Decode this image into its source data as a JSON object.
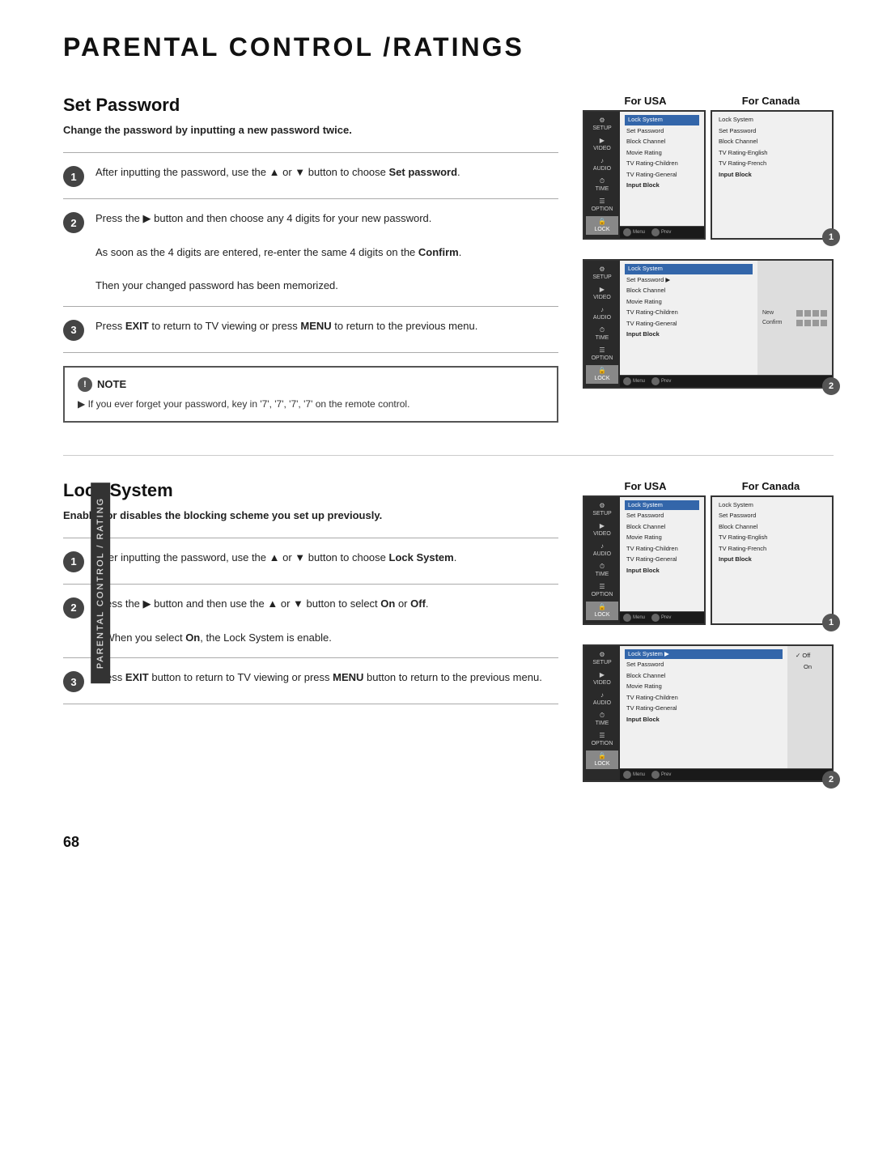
{
  "page": {
    "title": "PARENTAL CONTROL /RATINGS",
    "page_number": "68",
    "side_tab": "PARENTAL CONTROL / RATING"
  },
  "set_password": {
    "title": "Set Password",
    "subtitle": "Change the password by inputting a new password twice.",
    "steps": [
      {
        "number": "1",
        "text": "After inputting the password, use the ▲ or ▼ button to choose Set password."
      },
      {
        "number": "2",
        "text": "Press the ▶ button and then choose any 4 digits for your new password.\n\nAs soon as the 4 digits are entered, re-enter the same 4 digits on the Confirm.\n\nThen your changed password has been memorized."
      },
      {
        "number": "3",
        "text": "Press EXIT to return to TV viewing or press MENU to return to the previous menu."
      }
    ],
    "note": {
      "title": "NOTE",
      "text": "▶ If you ever forget your password, key in '7', '7', '7', '7' on the remote control."
    },
    "for_usa_label": "For USA",
    "for_canada_label": "For Canada",
    "screens": [
      {
        "badge": "1",
        "usa_menu": [
          "Lock System",
          "Set Password",
          "Block Channel",
          "Movie Rating",
          "TV Rating-Children",
          "TV Rating-General",
          "Input Block"
        ],
        "canada_menu": [
          "Lock System",
          "Set Password",
          "Block Channel",
          "TV Rating-English",
          "TV Rating-French",
          "Input Block"
        ],
        "selected_item": "Lock System",
        "sidebar": [
          "SETUP",
          "VIDEO",
          "AUDIO",
          "TIME",
          "OPTION",
          "LOCK"
        ]
      },
      {
        "badge": "2",
        "usa_menu": [
          "Lock System",
          "Set Password",
          "Block Channel",
          "Movie Rating",
          "TV Rating-Children",
          "TV Rating-General",
          "Input Block"
        ],
        "selected_item": "Lock System",
        "sidebar": [
          "SETUP",
          "VIDEO",
          "AUDIO",
          "TIME",
          "OPTION",
          "LOCK"
        ],
        "submenu": {
          "new_label": "New",
          "confirm_label": "Confirm",
          "dots": 4
        }
      }
    ]
  },
  "lock_system": {
    "title": "Lock System",
    "subtitle": "Enables or disables the blocking scheme you set up previously.",
    "steps": [
      {
        "number": "1",
        "text": "After inputting the password, use the ▲ or ▼ button to choose Lock System."
      },
      {
        "number": "2",
        "text": "Press the ▶ button and then use the ▲ or ▼ button to select On or Off.\n\n■ When you select On, the Lock System is enable."
      },
      {
        "number": "3",
        "text": "Press EXIT button to return to TV viewing or press MENU button to return to the previous menu."
      }
    ],
    "for_usa_label": "For USA",
    "for_canada_label": "For Canada",
    "screens": [
      {
        "badge": "1",
        "usa_menu": [
          "Lock System",
          "Set Password",
          "Block Channel",
          "Movie Rating",
          "TV Rating-Children",
          "TV Rating-General",
          "Input Block"
        ],
        "canada_menu": [
          "Lock System",
          "Set Password",
          "Block Channel",
          "TV Rating-English",
          "TV Rating-French",
          "Input Block"
        ],
        "selected_item": "Lock System",
        "sidebar": [
          "SETUP",
          "VIDEO",
          "AUDIO",
          "TIME",
          "OPTION",
          "LOCK"
        ]
      },
      {
        "badge": "2",
        "usa_menu": [
          "Lock System",
          "Set Password",
          "Block Channel",
          "Movie Rating",
          "TV Rating-Children",
          "TV Rating-General",
          "Input Block"
        ],
        "selected_item": "Lock System",
        "sidebar": [
          "SETUP",
          "VIDEO",
          "AUDIO",
          "TIME",
          "OPTION",
          "LOCK"
        ],
        "submenu": {
          "off_checked": true,
          "items": [
            "✓ Off",
            "On"
          ]
        }
      }
    ]
  },
  "sidebar_icons": {
    "setup": "⚙",
    "video": "▶",
    "audio": "♪",
    "time": "⏱",
    "option": "☰",
    "lock": "🔒"
  }
}
